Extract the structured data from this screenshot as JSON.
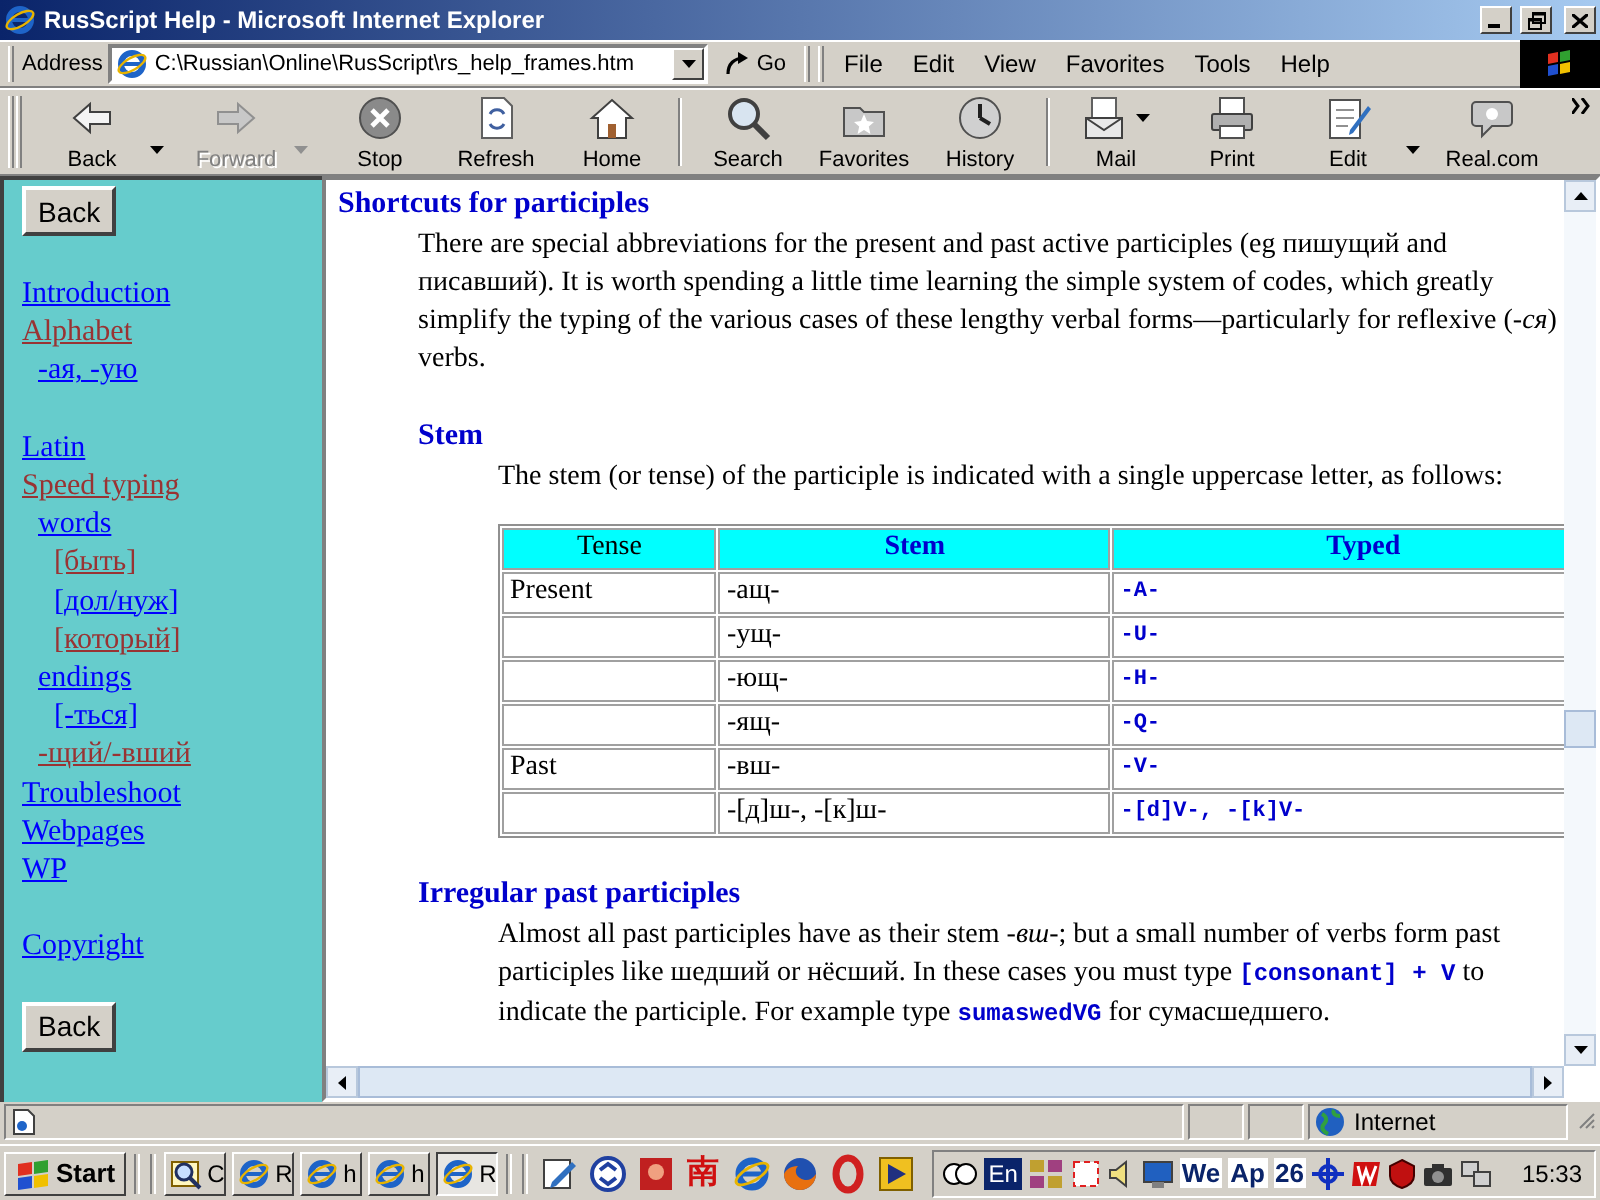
{
  "window": {
    "title": "RusScript Help - Microsoft Internet Explorer"
  },
  "address_bar": {
    "label": "Address",
    "value": "C:\\Russian\\Online\\RusScript\\rs_help_frames.htm",
    "go": "Go"
  },
  "menu": [
    "File",
    "Edit",
    "View",
    "Favorites",
    "Tools",
    "Help"
  ],
  "toolbar_groups": [
    [
      {
        "kind": "back",
        "label": "Back",
        "disabled": false,
        "dropdown": true
      },
      {
        "kind": "forward",
        "label": "Forward",
        "disabled": true,
        "dropdown": true
      },
      {
        "kind": "stop",
        "label": "Stop",
        "disabled": false,
        "dropdown": false
      },
      {
        "kind": "refresh",
        "label": "Refresh",
        "disabled": false,
        "dropdown": false
      },
      {
        "kind": "home",
        "label": "Home",
        "disabled": false,
        "dropdown": false
      }
    ],
    [
      {
        "kind": "search",
        "label": "Search",
        "disabled": false,
        "dropdown": false
      },
      {
        "kind": "favorites",
        "label": "Favorites",
        "disabled": false,
        "dropdown": false
      },
      {
        "kind": "history",
        "label": "History",
        "disabled": false,
        "dropdown": false
      }
    ],
    [
      {
        "kind": "mail",
        "label": "Mail",
        "disabled": false,
        "dropdown": true
      },
      {
        "kind": "print",
        "label": "Print",
        "disabled": false,
        "dropdown": false
      },
      {
        "kind": "edit",
        "label": "Edit",
        "disabled": false,
        "dropdown": true
      },
      {
        "kind": "discuss",
        "label": "Real.com",
        "disabled": false,
        "dropdown": false
      }
    ]
  ],
  "sidebar": {
    "top_button": "Back",
    "bottom_button": "Back",
    "link_groups": [
      [
        {
          "label": "Introduction",
          "visited": false
        },
        {
          "label": "Alphabet",
          "visited": true,
          "children": [
            {
              "label": "-ая, -ую",
              "visited": false
            }
          ]
        }
      ],
      [
        {
          "label": "Latin",
          "visited": false
        },
        {
          "label": "Speed typing",
          "visited": true,
          "children": [
            {
              "label": "words",
              "visited": false,
              "children": [
                {
                  "label": "[быть]",
                  "visited": true
                },
                {
                  "label": "[дол/нуж]",
                  "visited": false
                },
                {
                  "label": "[который]",
                  "visited": true
                }
              ]
            },
            {
              "label": "endings",
              "visited": false,
              "children": [
                {
                  "label": "[-ться]",
                  "visited": false
                }
              ]
            },
            {
              "label": "-щий/-вший",
              "visited": true
            }
          ]
        },
        {
          "label": "Troubleshoot",
          "visited": false
        },
        {
          "label": "Webpages",
          "visited": false
        },
        {
          "label": "WP",
          "visited": false
        }
      ],
      [
        {
          "label": "Copyright",
          "visited": false
        }
      ]
    ]
  },
  "content": {
    "heading": "Shortcuts for participles",
    "intro": "There are special abbreviations for the present and past active participles (eg пишущий and писавший). It is worth spending a little time learning the simple system of codes, which greatly simplify the typing of the various cases of these lengthy verbal forms—particularly for reflexive (-*ся*) verbs.",
    "sections": [
      {
        "heading": "Stem",
        "text": "The stem (or tense) of the participle is indicated with a single uppercase letter, as follows:",
        "table": {
          "columns": [
            {
              "label": "Tense",
              "emphasis": false,
              "kind": "plain"
            },
            {
              "label": "Stem",
              "emphasis": true,
              "kind": "plain"
            },
            {
              "label": "Typed",
              "emphasis": true,
              "kind": "code"
            }
          ],
          "rows": [
            {
              "tense": "Present",
              "stem": "-ащ-",
              "typed": "-A-"
            },
            {
              "stem": "-ущ-",
              "typed": "-U-"
            },
            {
              "stem": "-ющ-",
              "typed": "-H-"
            },
            {
              "stem": "-ящ-",
              "typed": "-Q-"
            },
            {
              "tense": "Past",
              "stem": "-вш-",
              "typed": "-V-"
            },
            {
              "stem": "-[д]ш-, -[к]ш-",
              "typed": "-[d]V-, -[k]V-"
            }
          ]
        }
      },
      {
        "heading": "Irregular past participles",
        "text": "Almost all past participles have as their stem -*вш*-; but a small number of verbs form past participles like шедший or нёсший. In these cases you must type **[consonant] + V** to indicate the participle. For example type **sumaswedVG** for сумасшедшего."
      }
    ]
  },
  "status_bar": {
    "zone": "Internet"
  },
  "taskbar": {
    "start": "Start",
    "tasks": [
      {
        "kind": "search",
        "label": "C",
        "selected": false
      },
      {
        "kind": "browser",
        "label": "R",
        "selected": false
      },
      {
        "kind": "browser",
        "label": "h",
        "selected": false
      },
      {
        "kind": "browser",
        "label": "h",
        "selected": false
      },
      {
        "kind": "browser",
        "label": "R",
        "selected": true
      }
    ],
    "quick_launch": [
      {
        "kind": "notepad"
      },
      {
        "kind": "sync"
      },
      {
        "kind": "game"
      },
      {
        "kind": "glyph",
        "text": "南"
      },
      {
        "kind": "browser"
      },
      {
        "kind": "fox"
      },
      {
        "kind": "ring"
      },
      {
        "kind": "play"
      }
    ],
    "tray": {
      "language": "En",
      "day": "We",
      "month": "Ap",
      "date": "26",
      "time": "15:33"
    }
  }
}
